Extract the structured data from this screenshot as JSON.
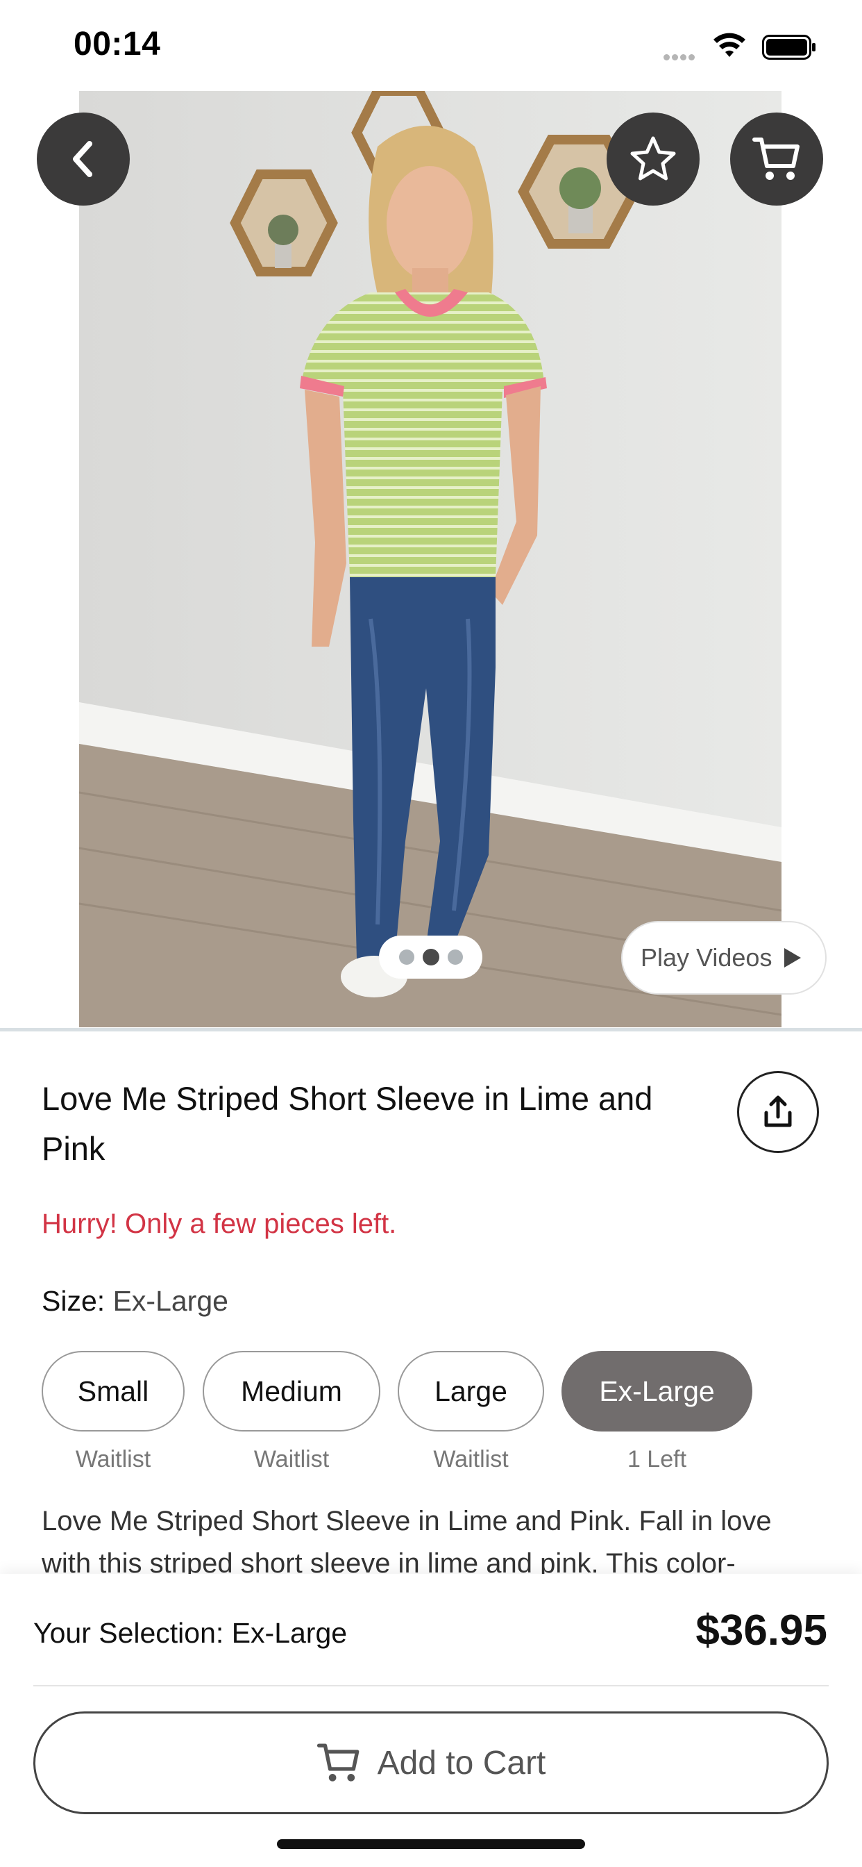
{
  "status_bar": {
    "time": "00:14"
  },
  "hero": {
    "carousel": {
      "count": 3,
      "active_index": 1
    },
    "play_videos_label": "Play Videos",
    "icons": {
      "back": "chevron-left-icon",
      "favorite": "star-icon",
      "cart": "cart-icon",
      "play": "play-icon",
      "share": "share-icon"
    }
  },
  "product": {
    "title": "Love Me Striped Short Sleeve in Lime and Pink",
    "stock_warning": "Hurry! Only a few pieces left.",
    "size_label": "Size",
    "selected_size": "Ex-Large",
    "sizes": [
      {
        "label": "Small",
        "status": "Waitlist"
      },
      {
        "label": "Medium",
        "status": "Waitlist"
      },
      {
        "label": "Large",
        "status": "Waitlist"
      },
      {
        "label": "Ex-Large",
        "status": "1 Left",
        "selected": true
      }
    ],
    "description": "Love Me Striped Short Sleeve in Lime and Pink. Fall in love with this striped short sleeve in lime and pink. This color-"
  },
  "bottom_bar": {
    "selection_label": "Your Selection",
    "selection_value": "Ex-Large",
    "price": "$36.95",
    "add_to_cart_label": "Add to Cart"
  },
  "colors": {
    "warning": "#d23445",
    "selected_chip": "#716d6d",
    "icon_button": "#3b3a3a"
  }
}
